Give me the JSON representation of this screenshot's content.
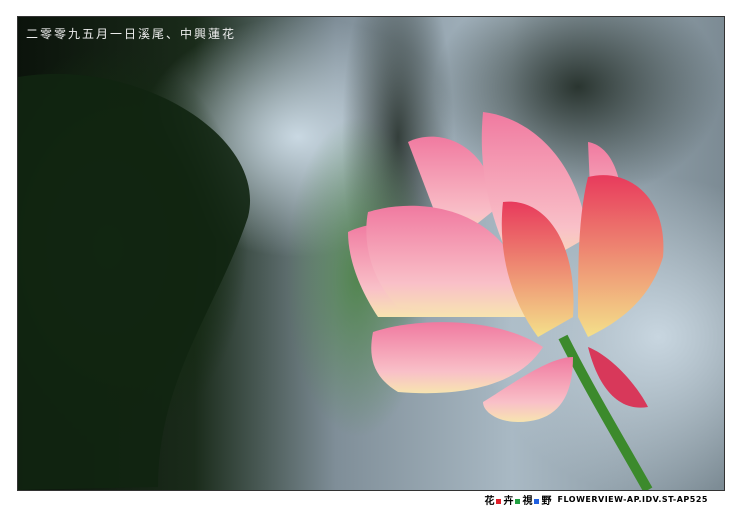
{
  "caption": "二零零九五月一日溪尾、中興蓮花",
  "footer": {
    "logo_chars": [
      "花",
      "卉",
      "視",
      "野"
    ],
    "logo_colors": [
      "#e0202a",
      "#20a040",
      "#2060e0"
    ],
    "site": "FLOWERVIEW-AP.IDV.ST-AP525"
  }
}
